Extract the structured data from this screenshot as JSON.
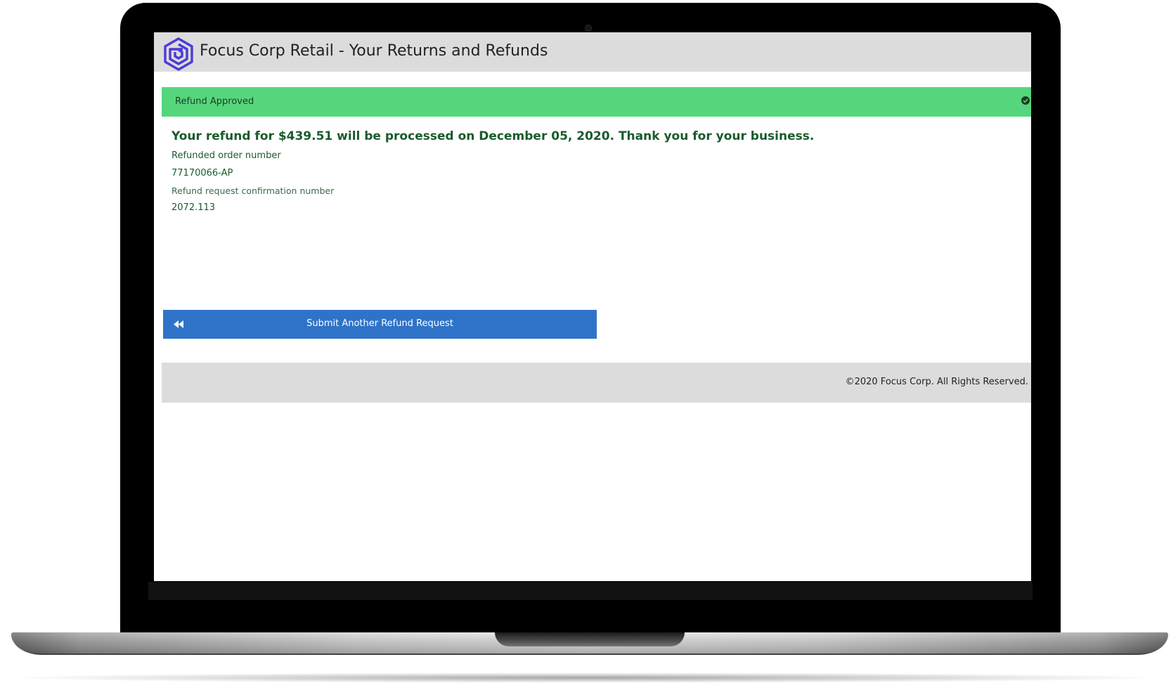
{
  "app": {
    "title": "Focus Corp Retail - Your Returns and Refunds",
    "logo_icon": "focus-corp-logo-icon",
    "brand_color": "#4b3bd6"
  },
  "banner": {
    "label": "Refund Approved",
    "status_icon": "check-circle-icon",
    "color": "#56d67c"
  },
  "refund": {
    "message": "Your refund for $439.51 will be processed on December 05, 2020. Thank you for your business.",
    "order_number_label": "Refunded order number",
    "order_number": "77170066-AP",
    "confirmation_label": "Refund request confirmation number",
    "confirmation_number": "2072.113"
  },
  "action": {
    "label": "Submit Another Refund Request",
    "icon": "rewind-icon",
    "color": "#2f73c9"
  },
  "footer": {
    "copyright": "©2020 Focus Corp. All Rights Reserved."
  }
}
